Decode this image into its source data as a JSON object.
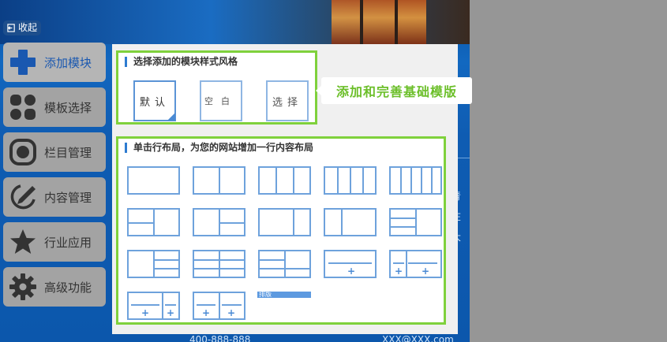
{
  "collapse": {
    "label": "收起"
  },
  "sidebar": {
    "items": [
      {
        "label": "添加模块",
        "icon": "plus-icon"
      },
      {
        "label": "模板选择",
        "icon": "grid-icon"
      },
      {
        "label": "栏目管理",
        "icon": "record-icon"
      },
      {
        "label": "内容管理",
        "icon": "pencil-icon"
      },
      {
        "label": "行业应用",
        "icon": "star-icon"
      },
      {
        "label": "高级功能",
        "icon": "gear-icon"
      }
    ]
  },
  "style_section": {
    "title": "选择添加的模块样式风格",
    "options": [
      {
        "label": "默认",
        "selected": true
      },
      {
        "label": "空白",
        "selected": false
      },
      {
        "label": "选择",
        "selected": false
      }
    ]
  },
  "tooltip": {
    "text": "添加和完善基础模版"
  },
  "layout_section": {
    "title": "单击行布局，为您的网站增加一行内容布局",
    "sort_label": "排版"
  },
  "background": {
    "side_text": [
      "青",
      "在",
      "大"
    ],
    "phone": "400-888-888",
    "email": "XXX@XXX.com"
  },
  "colors": {
    "accent_green": "#7fd13c",
    "accent_blue": "#2e7bd0",
    "layout_line": "#6ea2dc"
  }
}
